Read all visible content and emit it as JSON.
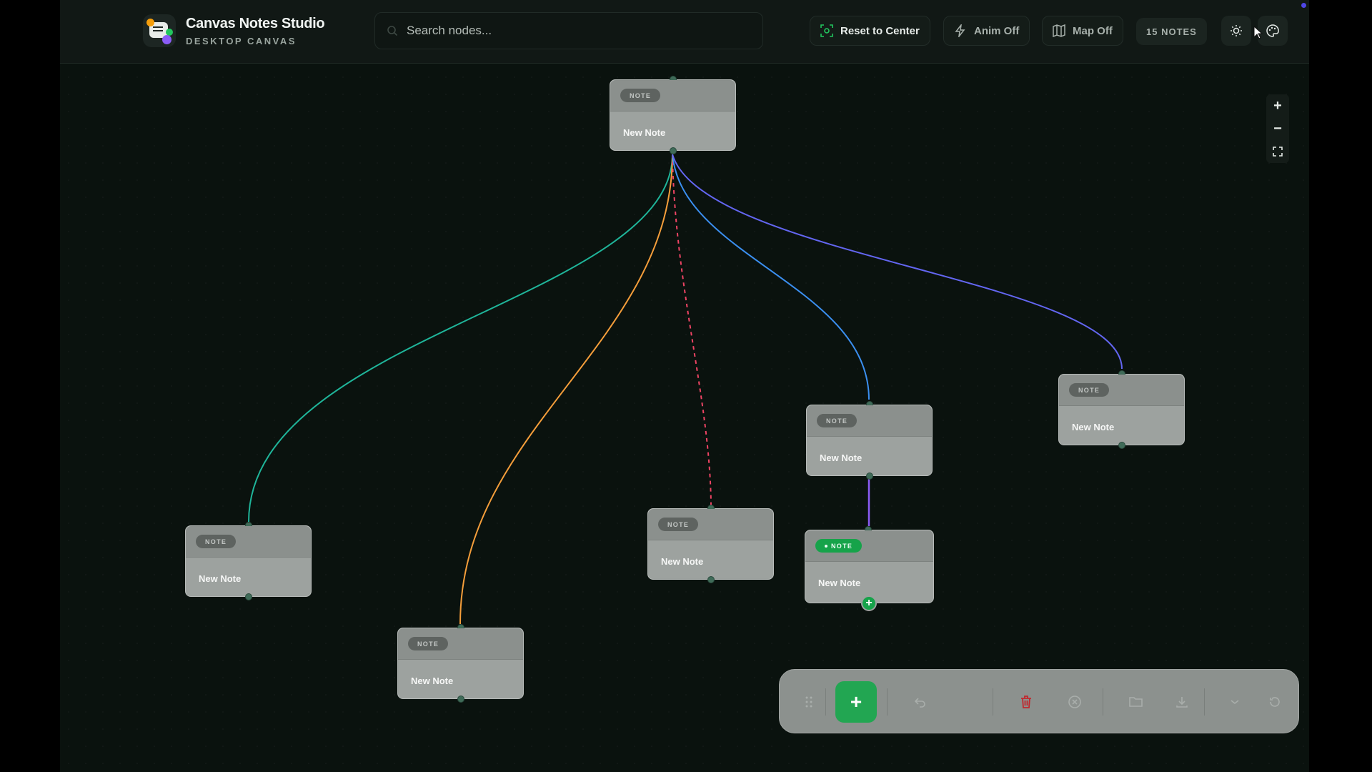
{
  "app": {
    "title": "Canvas Notes Studio",
    "subtitle": "DESKTOP CANVAS"
  },
  "search": {
    "placeholder": "Search nodes...",
    "value": ""
  },
  "header_buttons": {
    "reset_label": "Reset to Center",
    "anim_label": "Anim Off",
    "map_label": "Map Off",
    "count_label": "15 NOTES",
    "icons": [
      "sun-icon",
      "palette-icon"
    ]
  },
  "zoom_controls": {
    "zoom_in": "+",
    "zoom_out": "−",
    "fit": "fit-view-icon"
  },
  "nodes": [
    {
      "tag": "NOTE",
      "title": "New Note"
    },
    {
      "tag": "NOTE",
      "title": "New Note"
    },
    {
      "tag": "NOTE",
      "title": "New Note"
    },
    {
      "tag": "NOTE",
      "title": "New Note"
    },
    {
      "tag": "NOTE",
      "title": "New Note"
    },
    {
      "tag": "NOTE",
      "title": "New Note"
    },
    {
      "tag": "NOTE",
      "title": "New Note",
      "selected": true
    }
  ],
  "edge_colors": {
    "teal": "#1fb59a",
    "orange": "#f59e3b",
    "red_dashed": "#ef4464",
    "blue": "#3b8ff0",
    "indigo": "#6366f1",
    "violet": "#8b5cf6"
  },
  "toolbar": {
    "add_label": "+",
    "icons": [
      "drag-handle-icon",
      "add-icon",
      "undo-icon",
      "trash-icon",
      "clear-icon",
      "folder-open-icon",
      "download-icon",
      "chevron-down-icon",
      "reset-icon"
    ],
    "accent": "#22a652",
    "danger": "#c0292e"
  }
}
